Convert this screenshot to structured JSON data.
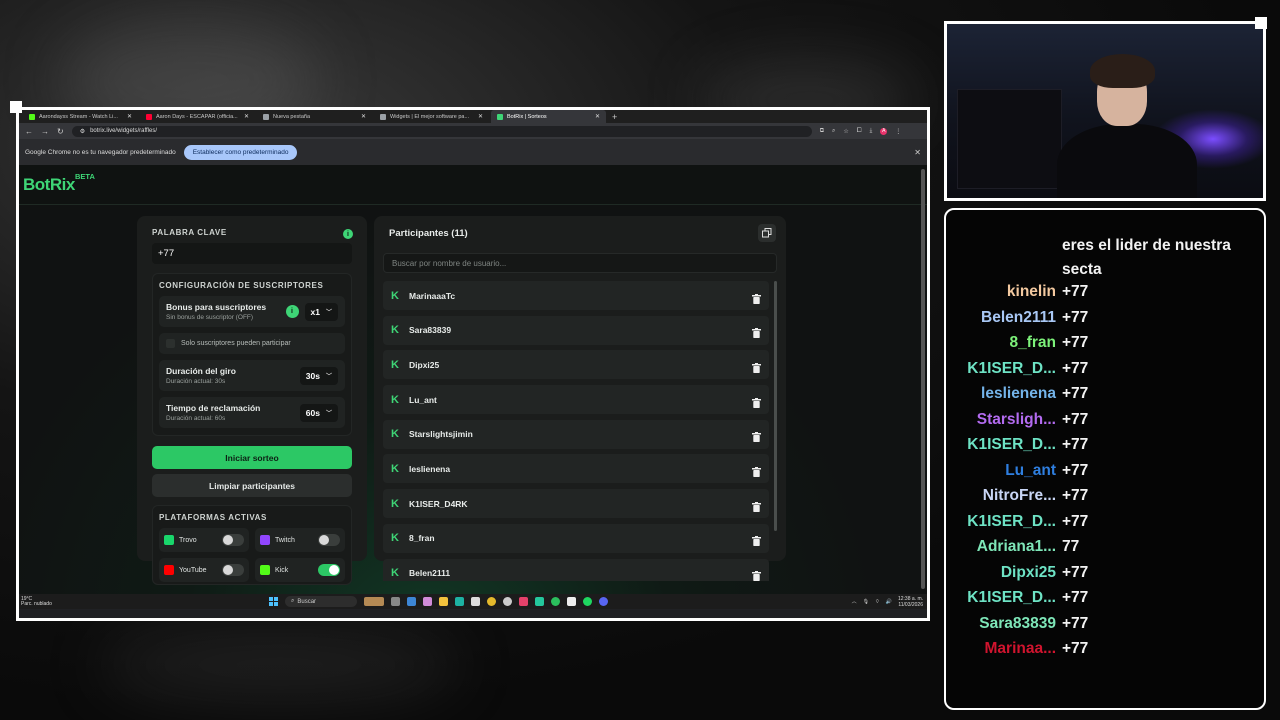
{
  "browser": {
    "tabs": [
      {
        "label": "Aarondayss Stream - Watch Li...",
        "color": "#53fc18",
        "active": false
      },
      {
        "label": "Aaron Days - ESCAPAR (officia...",
        "color": "#ff0033",
        "active": false
      },
      {
        "label": "Nueva pestaña",
        "color": "#9aa0a6",
        "active": false
      },
      {
        "label": "Widgets | El mejor software pa...",
        "color": "#9aa0a6",
        "active": false
      },
      {
        "label": "BotRix | Sorteos",
        "color": "#3ed576",
        "active": true
      }
    ],
    "url": "botrix.live/widgets/raffles/",
    "infobar_text": "Google Chrome no es tu navegador predeterminado",
    "infobar_button": "Establecer como predeterminado",
    "profile_initial": "A"
  },
  "app": {
    "logo": "BotRix",
    "beta": "BETA",
    "keyword": {
      "title": "PALABRA CLAVE",
      "value": "+77"
    },
    "subs_config": {
      "title": "CONFIGURACIÓN DE SUSCRIPTORES",
      "bonus": {
        "label": "Bonus para suscriptores",
        "sub": "Sin bonus de suscriptor (OFF)",
        "value": "x1"
      },
      "only_subs": "Solo suscriptores pueden participar",
      "duration": {
        "label": "Duración del giro",
        "sub": "Duración actual: 30s",
        "value": "30s"
      },
      "claim": {
        "label": "Tiempo de reclamación",
        "sub": "Duración actual: 60s",
        "value": "60s"
      }
    },
    "start_button": "Iniciar sorteo",
    "clear_button": "Limpiar participantes",
    "platforms": {
      "title": "PLATAFORMAS ACTIVAS",
      "items": [
        {
          "name": "Trovo",
          "color": "#19d66b",
          "enabled": false
        },
        {
          "name": "Twitch",
          "color": "#9146ff",
          "enabled": false
        },
        {
          "name": "YouTube",
          "color": "#ff0000",
          "enabled": false
        },
        {
          "name": "Kick",
          "color": "#53fc18",
          "enabled": true
        }
      ]
    },
    "participants": {
      "title": "Participantes (11)",
      "search_placeholder": "Buscar por nombre de usuario...",
      "list": [
        "MarinaaaTc",
        "Sara83839",
        "Dipxi25",
        "Lu_ant",
        "Starslightsjimin",
        "leslienena",
        "K1ISER_D4RK",
        "8_fran",
        "Belen2111"
      ]
    }
  },
  "taskbar": {
    "weather_temp": "19°C",
    "weather_desc": "Parc. nublado",
    "search": "Buscar",
    "time": "12:38 a. m.",
    "date": "11/03/2026"
  },
  "chat": {
    "top_message": "eres el lider de nuestra secta",
    "lines": [
      {
        "user": "kinelin",
        "msg": "+77",
        "color": "#f3c9a0"
      },
      {
        "user": "Belen2111",
        "msg": "+77",
        "color": "#a9c8f5"
      },
      {
        "user": "8_fran",
        "msg": "+77",
        "color": "#7df27a"
      },
      {
        "user": "K1ISER_D...",
        "msg": "+77",
        "color": "#6ee3c5"
      },
      {
        "user": "leslienena",
        "msg": "+77",
        "color": "#74b4ea"
      },
      {
        "user": "Starsligh...",
        "msg": "+77",
        "color": "#b36bf0"
      },
      {
        "user": "K1ISER_D...",
        "msg": "+77",
        "color": "#6ee3c5"
      },
      {
        "user": "Lu_ant",
        "msg": "+77",
        "color": "#2f7fe0"
      },
      {
        "user": "NitroFre...",
        "msg": "+77",
        "color": "#c9d6f5"
      },
      {
        "user": "K1ISER_D...",
        "msg": "+77",
        "color": "#6ee3c5"
      },
      {
        "user": "Adriana1...",
        "msg": "77",
        "color": "#7ee6b8"
      },
      {
        "user": "Dipxi25",
        "msg": "+77",
        "color": "#6ee3c5"
      },
      {
        "user": "K1ISER_D...",
        "msg": "+77",
        "color": "#6ee3c5"
      },
      {
        "user": "Sara83839",
        "msg": "+77",
        "color": "#7ee6b8"
      },
      {
        "user": "Marinaa...",
        "msg": "+77",
        "color": "#d0142e"
      }
    ]
  }
}
